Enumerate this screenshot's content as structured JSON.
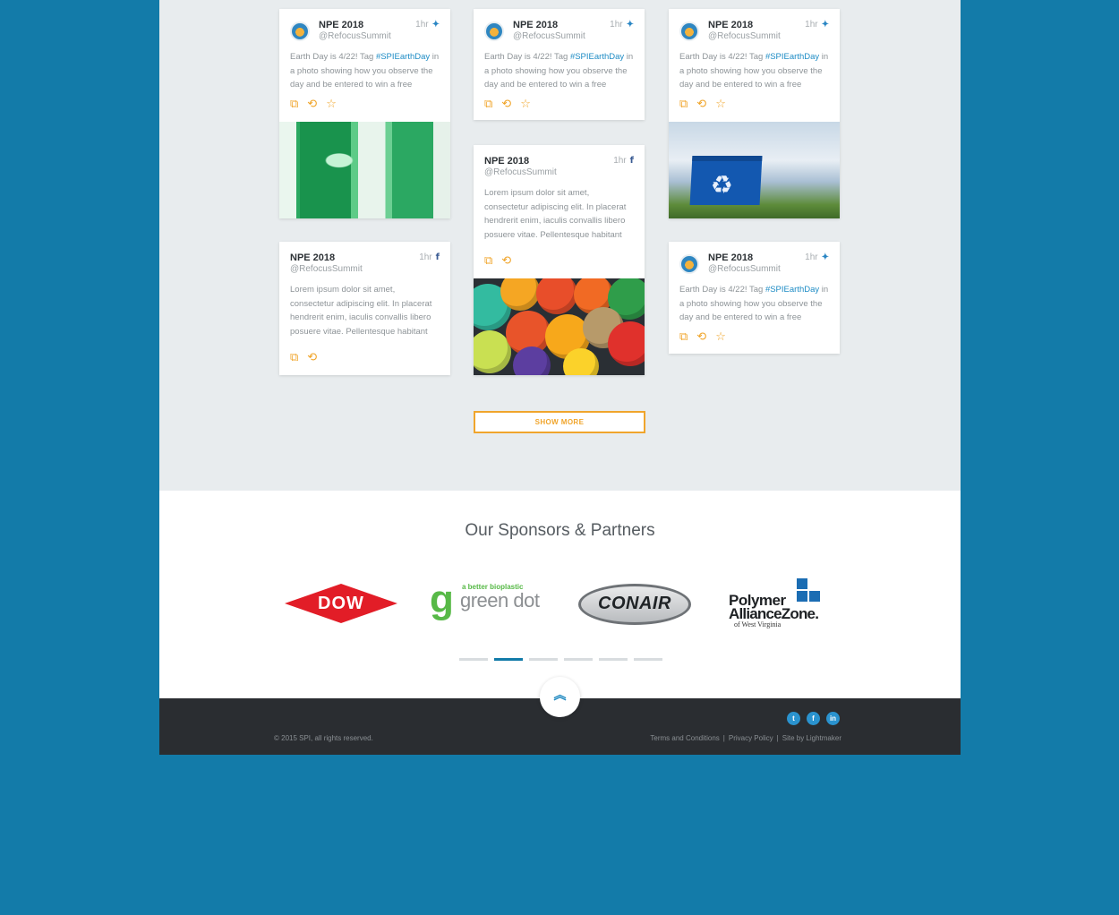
{
  "feed": {
    "posts": [
      {
        "name": "NPE 2018",
        "handle": "@RefocusSummit",
        "time": "1hr",
        "network": "twitter",
        "text": "Earth Day is 4/22!  Tag ",
        "tag": "#SPIEarthDay",
        "text2": " in a photo showing how you observe the day and be entered to win a free"
      },
      {
        "name": "NPE 2018",
        "handle": "@RefocusSummit",
        "time": "1hr",
        "network": "twitter",
        "text": "Earth Day is 4/22!  Tag ",
        "tag": "#SPIEarthDay",
        "text2": " in a photo showing how you observe the day and be entered to win a free"
      },
      {
        "name": "NPE 2018",
        "handle": "@RefocusSummit",
        "time": "1hr",
        "network": "twitter",
        "text": "Earth Day is 4/22!  Tag ",
        "tag": "#SPIEarthDay",
        "text2": " in a photo showing how you observe the day and be entered to win a free"
      },
      {
        "name": "NPE 2018",
        "handle": "@RefocusSummit",
        "time": "1hr",
        "network": "facebook",
        "text": "Lorem ipsum dolor sit amet, consectetur adipiscing elit. In placerat hendrerit enim, iaculis convallis libero posuere vitae. Pellentesque habitant"
      },
      {
        "name": "NPE 2018",
        "handle": "@RefocusSummit",
        "time": "1hr",
        "network": "facebook",
        "text": "Lorem ipsum dolor sit amet, consectetur adipiscing elit. In placerat hendrerit enim, iaculis convallis libero posuere vitae. Pellentesque habitant"
      },
      {
        "name": "NPE 2018",
        "handle": "@RefocusSummit",
        "time": "1hr",
        "network": "twitter",
        "text": "Earth Day is 4/22!  Tag ",
        "tag": "#SPIEarthDay",
        "text2": " in a photo showing how you observe the day and be entered to win a free"
      }
    ],
    "icons": {
      "reply": "reply-icon",
      "retweet": "retweet-icon",
      "favorite": "star-icon",
      "twitter": "twitter-icon",
      "facebook": "facebook-icon"
    },
    "show_more": "SHOW MORE"
  },
  "sponsors": {
    "title": "Our Sponsors & Partners",
    "logos": [
      {
        "text": "DOW"
      },
      {
        "letter": "g",
        "tagline": "a better bioplastic",
        "word": "green dot"
      },
      {
        "text": "CONAIR"
      },
      {
        "line1": "Polymer",
        "line2": "AllianceZone.",
        "line3": "of West Virginia"
      }
    ],
    "carousel_pages": 6,
    "carousel_active": 2
  },
  "footer": {
    "copyright": "© 2015 SPI, all rights reserved.",
    "links": [
      "Terms and Conditions",
      "Privacy Policy",
      "Site by Lightmaker"
    ],
    "separator": "|",
    "social": [
      "twitter-icon",
      "facebook-icon",
      "linkedin-icon"
    ]
  },
  "colors": {
    "background": "#137ba9",
    "accent": "#f0a52c",
    "link": "#1e8cc5",
    "footer": "#2a2d31"
  }
}
